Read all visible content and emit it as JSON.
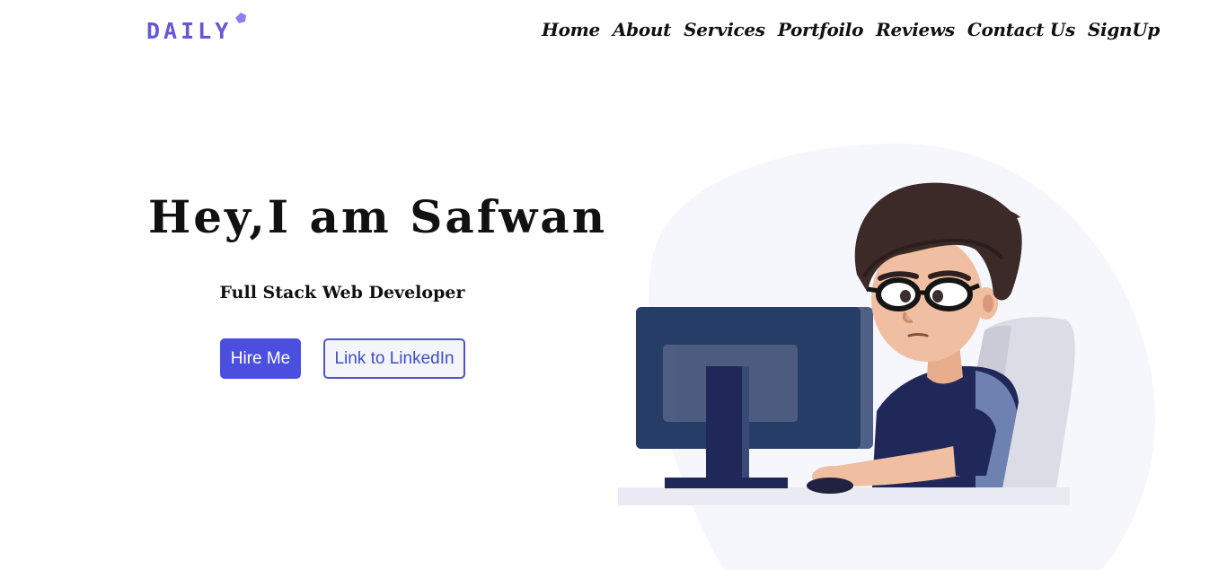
{
  "header": {
    "logo_text": "DAILY",
    "nav": [
      {
        "label": "Home"
      },
      {
        "label": "About"
      },
      {
        "label": "Services"
      },
      {
        "label": "Portfoilo"
      },
      {
        "label": "Reviews"
      },
      {
        "label": "Contact Us"
      },
      {
        "label": "SignUp"
      }
    ]
  },
  "hero": {
    "title": "Hey,I am Safwan",
    "subtitle": "Full Stack Web Developer",
    "primary_button": "Hire Me",
    "secondary_button": "Link to LinkedIn"
  },
  "colors": {
    "accent": "#4b4fe0",
    "logo": "#6457d8",
    "blob": "#f6f6fd"
  },
  "illustration": {
    "icon": "developer-at-computer-illustration"
  }
}
